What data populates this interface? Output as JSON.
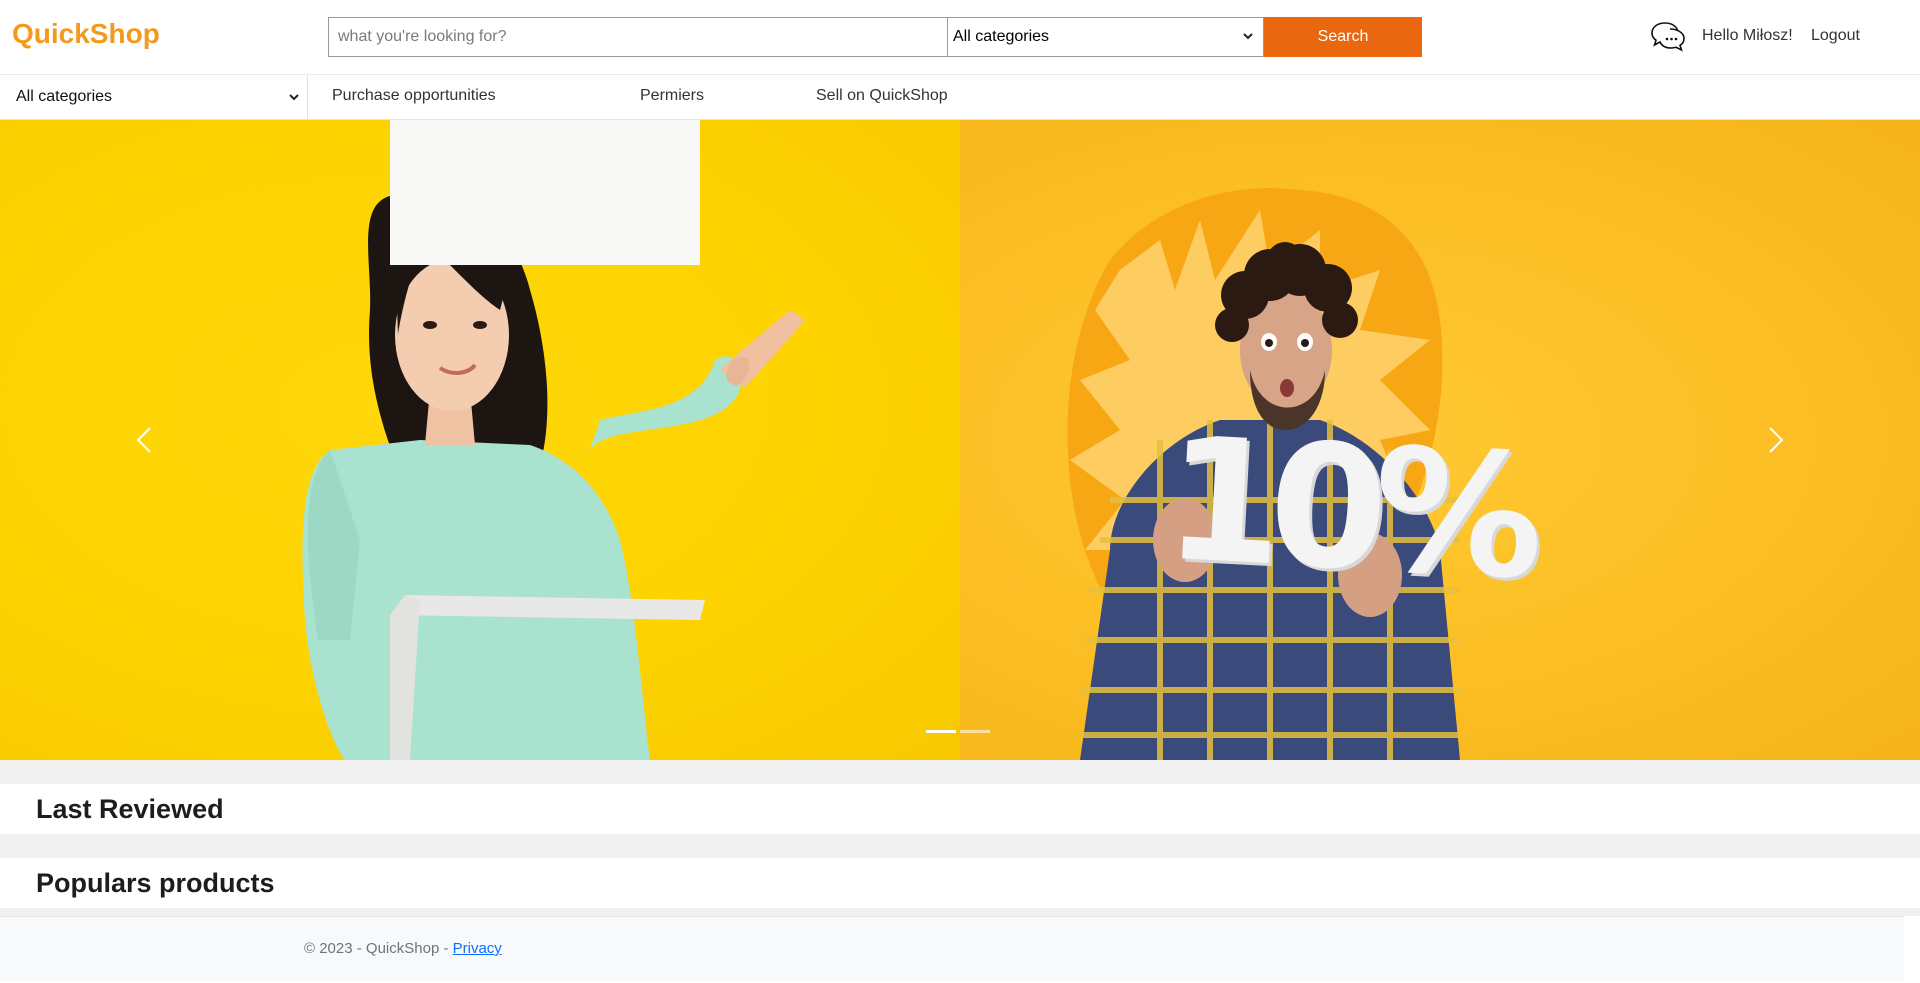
{
  "header": {
    "logo": "QuickShop",
    "search_placeholder": "what you're looking for?",
    "category_select": "All categories",
    "search_button": "Search",
    "greeting": "Hello Miłosz!",
    "logout": "Logout",
    "accent_color": "#e8670f",
    "logo_color": "#f39a1e"
  },
  "nav": {
    "category_select": "All categories",
    "links": [
      "Purchase opportunities",
      "Permiers",
      "Sell on QuickShop"
    ]
  },
  "carousel": {
    "slides": [
      {
        "description_icon": "woman-pointing-with-box-image"
      },
      {
        "description_icon": "man-holding-10-percent-image",
        "overlay_text": "10%"
      }
    ],
    "active_index": 0,
    "indicator_count": 2
  },
  "sections": {
    "last_reviewed": "Last Reviewed",
    "popular_products": "Populars products"
  },
  "footer": {
    "copyright": "© 2023 - QuickShop - ",
    "privacy_link": "Privacy"
  }
}
